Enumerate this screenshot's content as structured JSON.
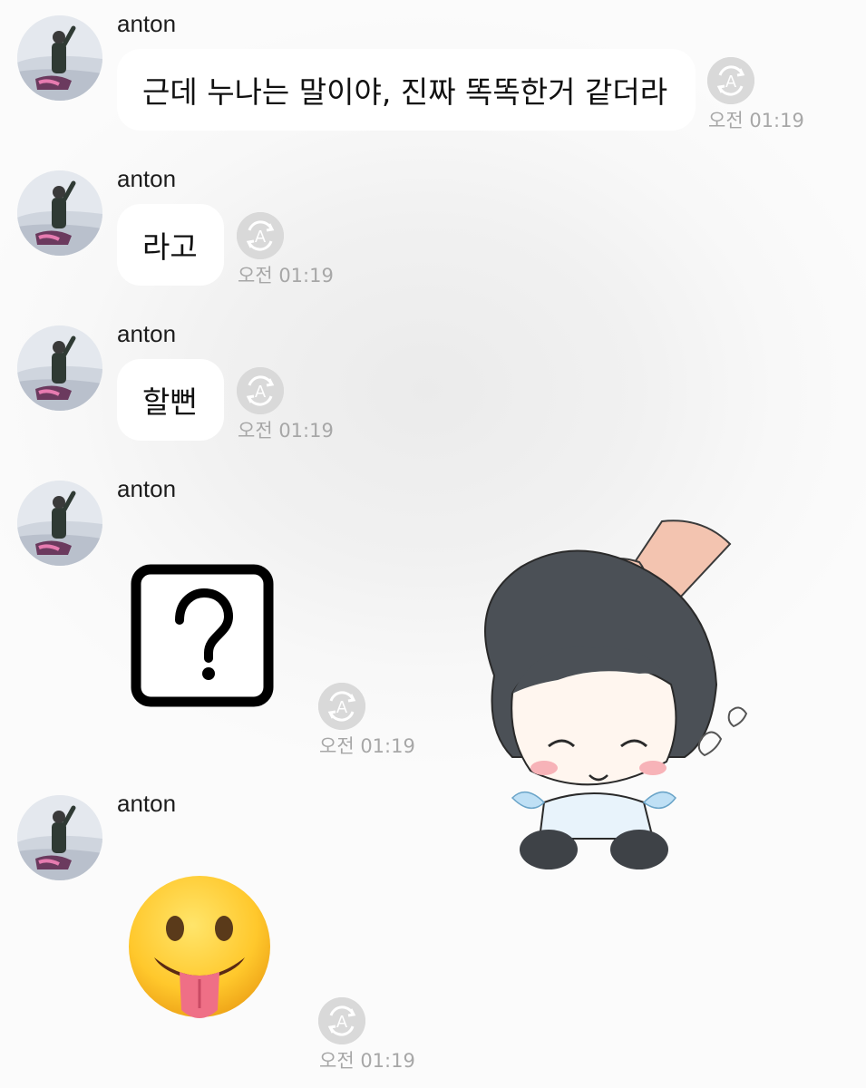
{
  "messages": [
    {
      "sender": "anton",
      "text": "근데 누나는 말이야, 진짜 똑똑한거 같더라",
      "time": "오전 01:19"
    },
    {
      "sender": "anton",
      "text": "라고",
      "time": "오전 01:19"
    },
    {
      "sender": "anton",
      "text": "할뻔",
      "time": "오전 01:19"
    },
    {
      "sender": "anton",
      "sticker": "question-mark-sticker",
      "time": "오전 01:19"
    },
    {
      "sender": "anton",
      "sticker": "tongue-out-emoji-sticker",
      "time": "오전 01:19"
    }
  ],
  "colors": {
    "bubble": "#ffffff",
    "translate_icon": "#d9d9d9",
    "timestamp": "#a7a7a7"
  }
}
